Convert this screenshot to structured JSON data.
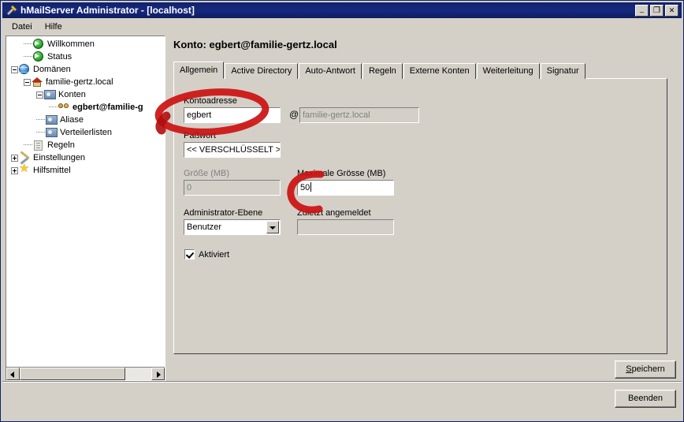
{
  "window": {
    "title": "hMailServer Administrator - [localhost]",
    "icon": "tools-icon",
    "controls": {
      "minimize": "_",
      "maximize": "❐",
      "close": "✕"
    }
  },
  "menu": {
    "items": [
      "Datei",
      "Hilfe"
    ]
  },
  "tree": {
    "nodes": [
      {
        "label": "Willkommen",
        "icon": "green-arrow-icon",
        "depth": 1,
        "expander": "none",
        "selected": false
      },
      {
        "label": "Status",
        "icon": "green-arrow-icon",
        "depth": 1,
        "expander": "none",
        "selected": false
      },
      {
        "label": "Domänen",
        "icon": "globe-icon",
        "depth": 0,
        "expander": "minus",
        "selected": false
      },
      {
        "label": "familie-gertz.local",
        "icon": "home-icon",
        "depth": 1,
        "expander": "minus",
        "selected": false
      },
      {
        "label": "Konten",
        "icon": "folder-users-icon",
        "depth": 2,
        "expander": "minus",
        "selected": false
      },
      {
        "label": "egbert@familie-g",
        "icon": "users-icon",
        "depth": 3,
        "expander": "none",
        "selected": true
      },
      {
        "label": "Aliase",
        "icon": "folder-users-icon",
        "depth": 2,
        "expander": "none",
        "selected": false
      },
      {
        "label": "Verteilerlisten",
        "icon": "folder-users-icon",
        "depth": 2,
        "expander": "none",
        "selected": false
      },
      {
        "label": "Regeln",
        "icon": "document-icon",
        "depth": 1,
        "expander": "none",
        "selected": false
      },
      {
        "label": "Einstellungen",
        "icon": "tools-icon",
        "depth": 0,
        "expander": "plus",
        "selected": false
      },
      {
        "label": "Hilfsmittel",
        "icon": "star-icon",
        "depth": 0,
        "expander": "plus",
        "selected": false
      }
    ],
    "hscroll": {
      "left_arrow": "◀",
      "right_arrow": "▶"
    }
  },
  "main": {
    "heading": "Konto: egbert@familie-gertz.local",
    "tabs": [
      {
        "label": "Allgemein",
        "active": true
      },
      {
        "label": "Active Directory",
        "active": false
      },
      {
        "label": "Auto-Antwort",
        "active": false
      },
      {
        "label": "Regeln",
        "active": false
      },
      {
        "label": "Externe Konten",
        "active": false
      },
      {
        "label": "Weiterleitung",
        "active": false
      },
      {
        "label": "Signatur",
        "active": false
      }
    ],
    "form": {
      "account_address_label": "Kontoadresse",
      "account_address_value": "egbert",
      "at_symbol": "@",
      "domain_value": "familie-gertz.local",
      "password_label": "Paßwort",
      "password_value": "<< VERSCHLÜSSELT >>",
      "size_label": "Größe (MB)",
      "size_value": "0",
      "max_size_label": "Maximale Grösse (MB)",
      "max_size_value": "50",
      "admin_level_label": "Administrator-Ebene",
      "admin_level_value": "Benutzer",
      "last_login_label": "Zuletzt angemeldet",
      "last_login_value": "",
      "enabled_label": "Aktiviert",
      "enabled_checked": true
    }
  },
  "footer": {
    "save_label_prefix": "S",
    "save_label_rest": "peichern",
    "save_label": "Speichern",
    "quit_label": "Beenden"
  },
  "annotations": {
    "color": "#cc1111",
    "marks": [
      {
        "name": "ellipse-around-kontoadresse",
        "shape": "ellipse"
      },
      {
        "name": "partial-circle-around-max-size",
        "shape": "c-arc"
      }
    ]
  }
}
